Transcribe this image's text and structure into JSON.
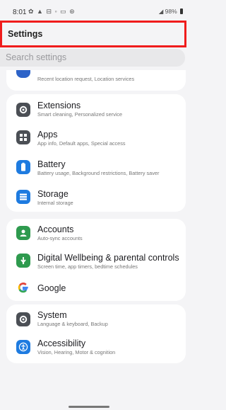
{
  "status_bar": {
    "time": "8:01",
    "notification_icons": "✿ ▲ ⊟ ◦ ▭ ⊛",
    "battery": "98%"
  },
  "header": {
    "title": "Settings"
  },
  "search": {
    "placeholder": "Search settings"
  },
  "groups": [
    {
      "items": [
        {
          "icon": "location-icon",
          "color": "#2d63c8",
          "label": "",
          "sub": "Recent location request, Location services"
        }
      ]
    },
    {
      "items": [
        {
          "icon": "extensions-icon",
          "color": "#4b4f55",
          "label": "Extensions",
          "sub": "Smart cleaning, Personalized service"
        },
        {
          "icon": "apps-icon",
          "color": "#4b4f55",
          "label": "Apps",
          "sub": "App info, Default apps, Special access"
        },
        {
          "icon": "battery-icon",
          "color": "#1e7be0",
          "label": "Battery",
          "sub": "Battery usage, Background restrictions, Battery saver"
        },
        {
          "icon": "storage-icon",
          "color": "#1e7be0",
          "label": "Storage",
          "sub": "Internal storage"
        }
      ]
    },
    {
      "items": [
        {
          "icon": "accounts-icon",
          "color": "#2e9a4e",
          "label": "Accounts",
          "sub": "Auto-sync accounts"
        },
        {
          "icon": "digital-wellbeing-icon",
          "color": "#2e9a4e",
          "label": "Digital Wellbeing & parental controls",
          "sub": "Screen time, app timers, bedtime schedules"
        },
        {
          "icon": "google-icon",
          "color": "#ffffff",
          "label": "Google",
          "sub": ""
        }
      ]
    },
    {
      "items": [
        {
          "icon": "system-icon",
          "color": "#4b4f55",
          "label": "System",
          "sub": "Language & keyboard, Backup"
        },
        {
          "icon": "accessibility-icon",
          "color": "#1e7be0",
          "label": "Accessibility",
          "sub": "Vision, Hearing, Motor & cognition"
        }
      ]
    }
  ]
}
